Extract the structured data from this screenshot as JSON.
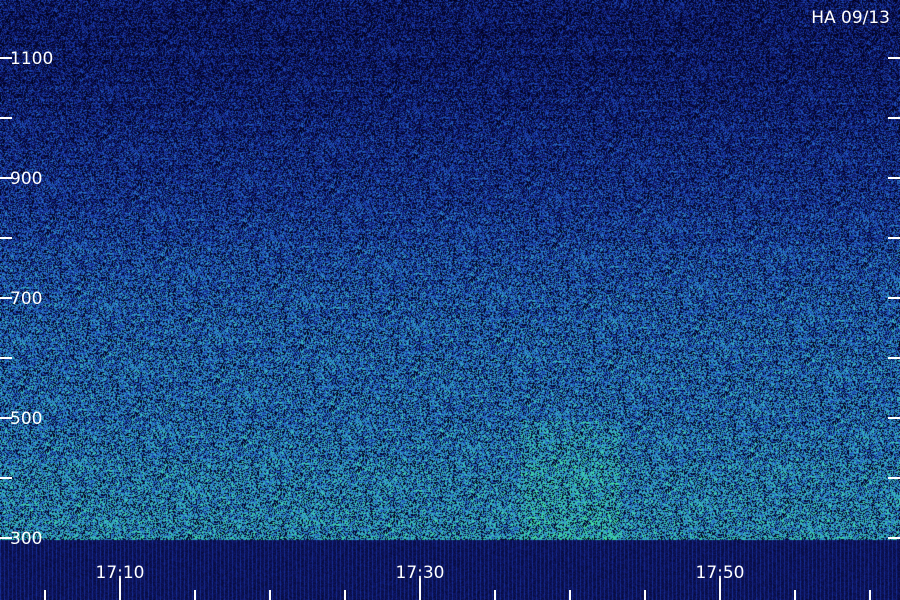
{
  "chart_data": {
    "type": "heatmap",
    "title": "HA 09/13",
    "xlabel": "",
    "ylabel": "",
    "y_ticks": [
      1100,
      900,
      700,
      500,
      300
    ],
    "y_minor_ticks": [
      1000,
      800,
      600,
      400
    ],
    "ylim": [
      300,
      1100
    ],
    "x_ticks": [
      "17:10",
      "17:30",
      "17:50"
    ],
    "x_minor_ticks": [
      "17:05",
      "17:15",
      "17:20",
      "17:25",
      "17:35",
      "17:40",
      "17:45",
      "17:55",
      "18:00"
    ],
    "xlim": [
      "17:02",
      "18:02"
    ],
    "colormap": [
      "#000018",
      "#10186a",
      "#1838a8",
      "#2a78c8",
      "#3ac0c0",
      "#40e890"
    ],
    "intensity_by_frequency": [
      {
        "y": 1100,
        "level": 0.25
      },
      {
        "y": 900,
        "level": 0.38
      },
      {
        "y": 700,
        "level": 0.55
      },
      {
        "y": 500,
        "level": 0.62
      },
      {
        "y": 300,
        "level": 0.72
      }
    ],
    "grid": false,
    "legend": "none"
  }
}
